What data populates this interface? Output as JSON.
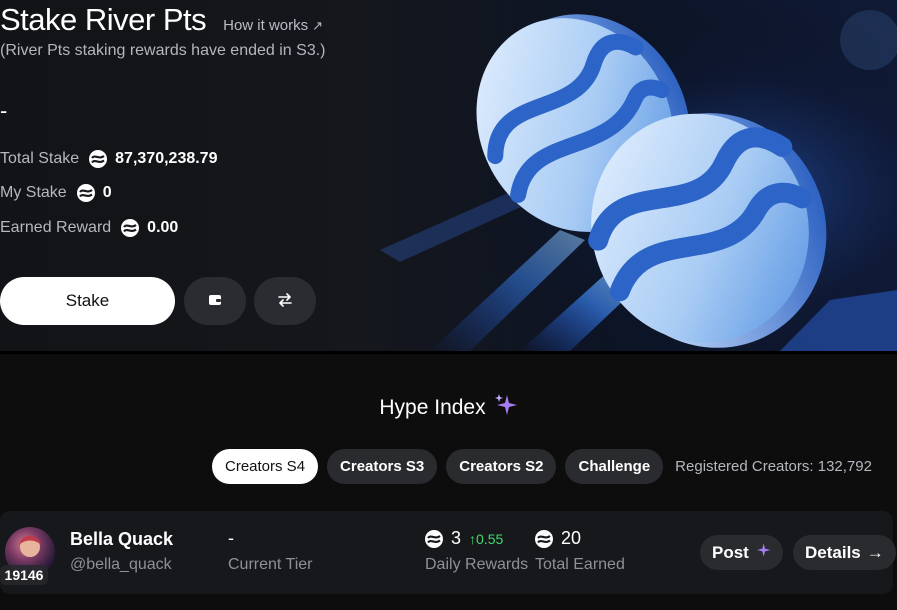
{
  "hero": {
    "title": "Stake River Pts",
    "how_it_works": "How it works",
    "subtitle": "(River Pts staking rewards have ended in S3.)",
    "apy": "-",
    "stats": [
      {
        "label": "Total Stake",
        "value": "87,370,238.79"
      },
      {
        "label": "My Stake",
        "value": "0"
      },
      {
        "label": "Earned Reward",
        "value": "0.00"
      }
    ],
    "stake_button": "Stake"
  },
  "hype": {
    "title": "Hype Index",
    "tabs": [
      "Creators S4",
      "Creators S3",
      "Creators S2",
      "Challenge"
    ],
    "active_tab": "Creators S4",
    "registered": "Registered Creators: 132,792"
  },
  "creator": {
    "rank": "19146",
    "name": "Bella Quack",
    "handle": "@bella_quack",
    "tier": "-",
    "tier_label": "Current Tier",
    "daily_rewards": "3",
    "daily_delta": "↑0.55",
    "daily_label": "Daily Rewards",
    "total_earned": "20",
    "total_label": "Total Earned",
    "post_button": "Post",
    "details_button": "Details"
  },
  "colors": {
    "accent_green": "#3ddc6b",
    "sparkle_purple": "#a77cf0",
    "coin_blue": "#4f8ee0"
  },
  "icons": [
    "arrow-up-right-icon",
    "river-pts-icon",
    "wallet-icon",
    "swap-icon",
    "sparkle-icon",
    "arrow-right-icon"
  ]
}
